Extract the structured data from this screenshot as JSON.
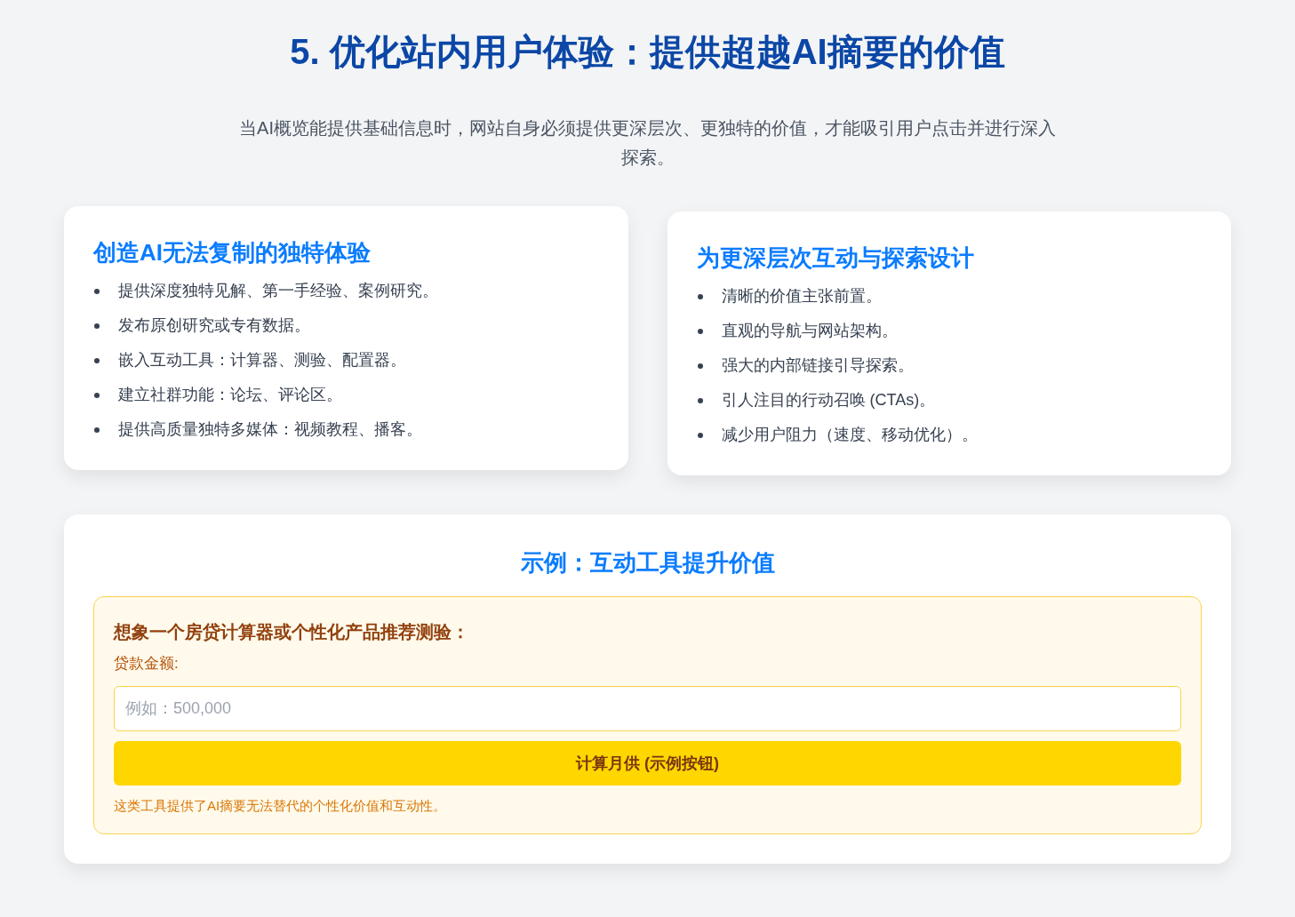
{
  "title": "5. 优化站内用户体验：提供超越AI摘要的价值",
  "intro": "当AI概览能提供基础信息时，网站自身必须提供更深层次、更独特的价值，才能吸引用户点击并进行深入探索。",
  "cards": [
    {
      "heading": "创造AI无法复制的独特体验",
      "items": [
        "提供深度独特见解、第一手经验、案例研究。",
        "发布原创研究或专有数据。",
        "嵌入互动工具：计算器、测验、配置器。",
        "建立社群功能：论坛、评论区。",
        "提供高质量独特多媒体：视频教程、播客。"
      ]
    },
    {
      "heading": "为更深层次互动与探索设计",
      "items": [
        "清晰的价值主张前置。",
        "直观的导航与网站架构。",
        "强大的内部链接引导探索。",
        "引人注目的行动召唤 (CTAs)。",
        "减少用户阻力（速度、移动优化）。"
      ]
    }
  ],
  "example": {
    "heading": "示例：互动工具提升价值",
    "box_title": "想象一个房贷计算器或个性化产品推荐测验：",
    "field_label": "贷款金额:",
    "field": {
      "placeholder": "例如：500,000"
    },
    "button": "计算月供 (示例按钮)",
    "note": "这类工具提供了AI摘要无法替代的个性化价值和互动性。"
  }
}
